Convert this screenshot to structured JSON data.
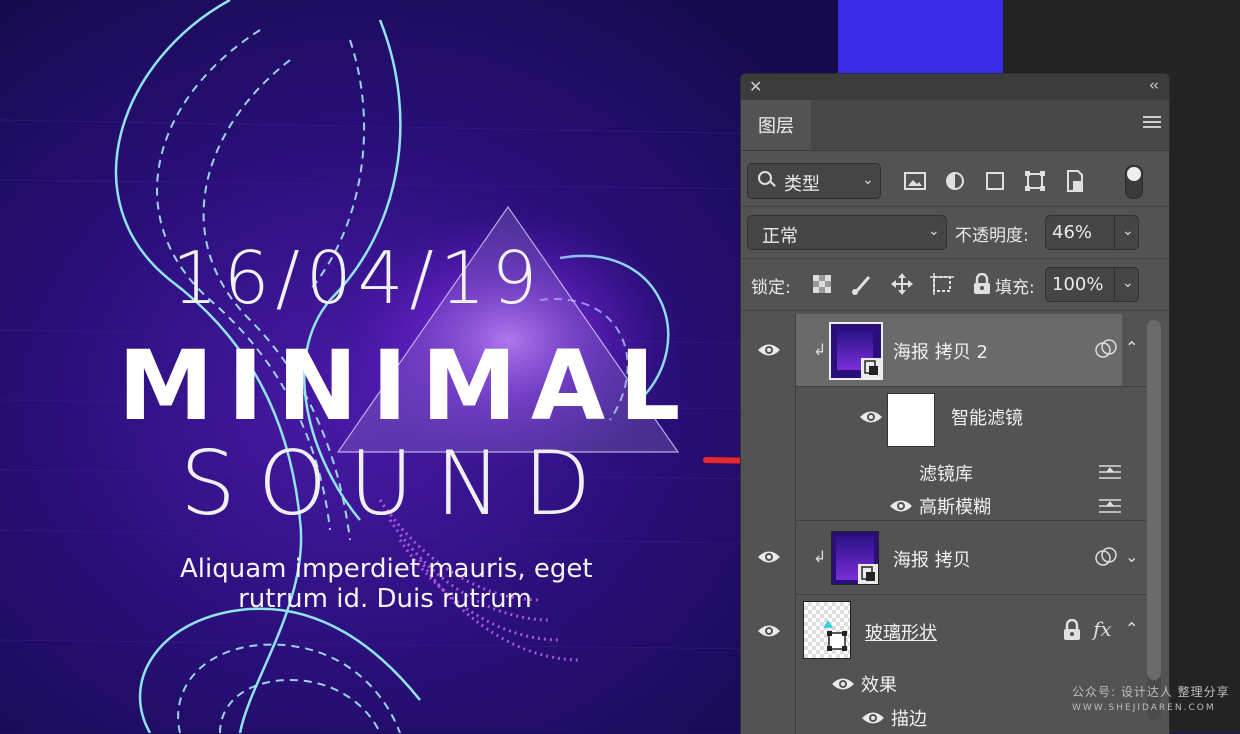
{
  "poster": {
    "date": "16/04/19",
    "title": "MINIMAL",
    "subtitle": "SOUND",
    "body_line1": "Aliquam imperdiet mauris, eget",
    "body_line2": "rutrum id. Duis rutrum"
  },
  "panel": {
    "tab_label": "图层",
    "filter_label": "类型",
    "blend_mode": "正常",
    "opacity_label": "不透明度:",
    "opacity_value": "46%",
    "lock_label": "锁定:",
    "fill_label": "填充:",
    "fill_value": "100%"
  },
  "layers": [
    {
      "name": "海报 拷贝 2",
      "visible": true,
      "clipped": true,
      "selected": true,
      "expanded": true,
      "type": "smart-object"
    },
    {
      "name": "智能滤镜",
      "visible": true,
      "type": "smart-filter"
    },
    {
      "name": "滤镜库",
      "type": "filter"
    },
    {
      "name": "高斯模糊",
      "visible": true,
      "type": "filter"
    },
    {
      "name": "海报 拷贝",
      "visible": true,
      "clipped": true,
      "expanded": false,
      "type": "smart-object"
    },
    {
      "name": "玻璃形状",
      "visible": true,
      "locked": true,
      "has_fx": true,
      "expanded": true,
      "type": "shape"
    },
    {
      "name": "效果",
      "visible": true,
      "type": "effect-group"
    },
    {
      "name": "描边",
      "visible": true,
      "type": "effect"
    }
  ],
  "fx_label": "fx",
  "watermark": {
    "line1": "公众号: 设计达人 整理分享",
    "line2": "WWW.SHEJIDAREN.COM"
  },
  "colors": {
    "poster_bg": "#1c0d5e",
    "wave_cyan": "#8fe4f0",
    "glow_purple": "#9b3cff",
    "accent_blue": "#3a2be6",
    "annotation_red": "#e8282c",
    "panel_bg": "#535353"
  }
}
